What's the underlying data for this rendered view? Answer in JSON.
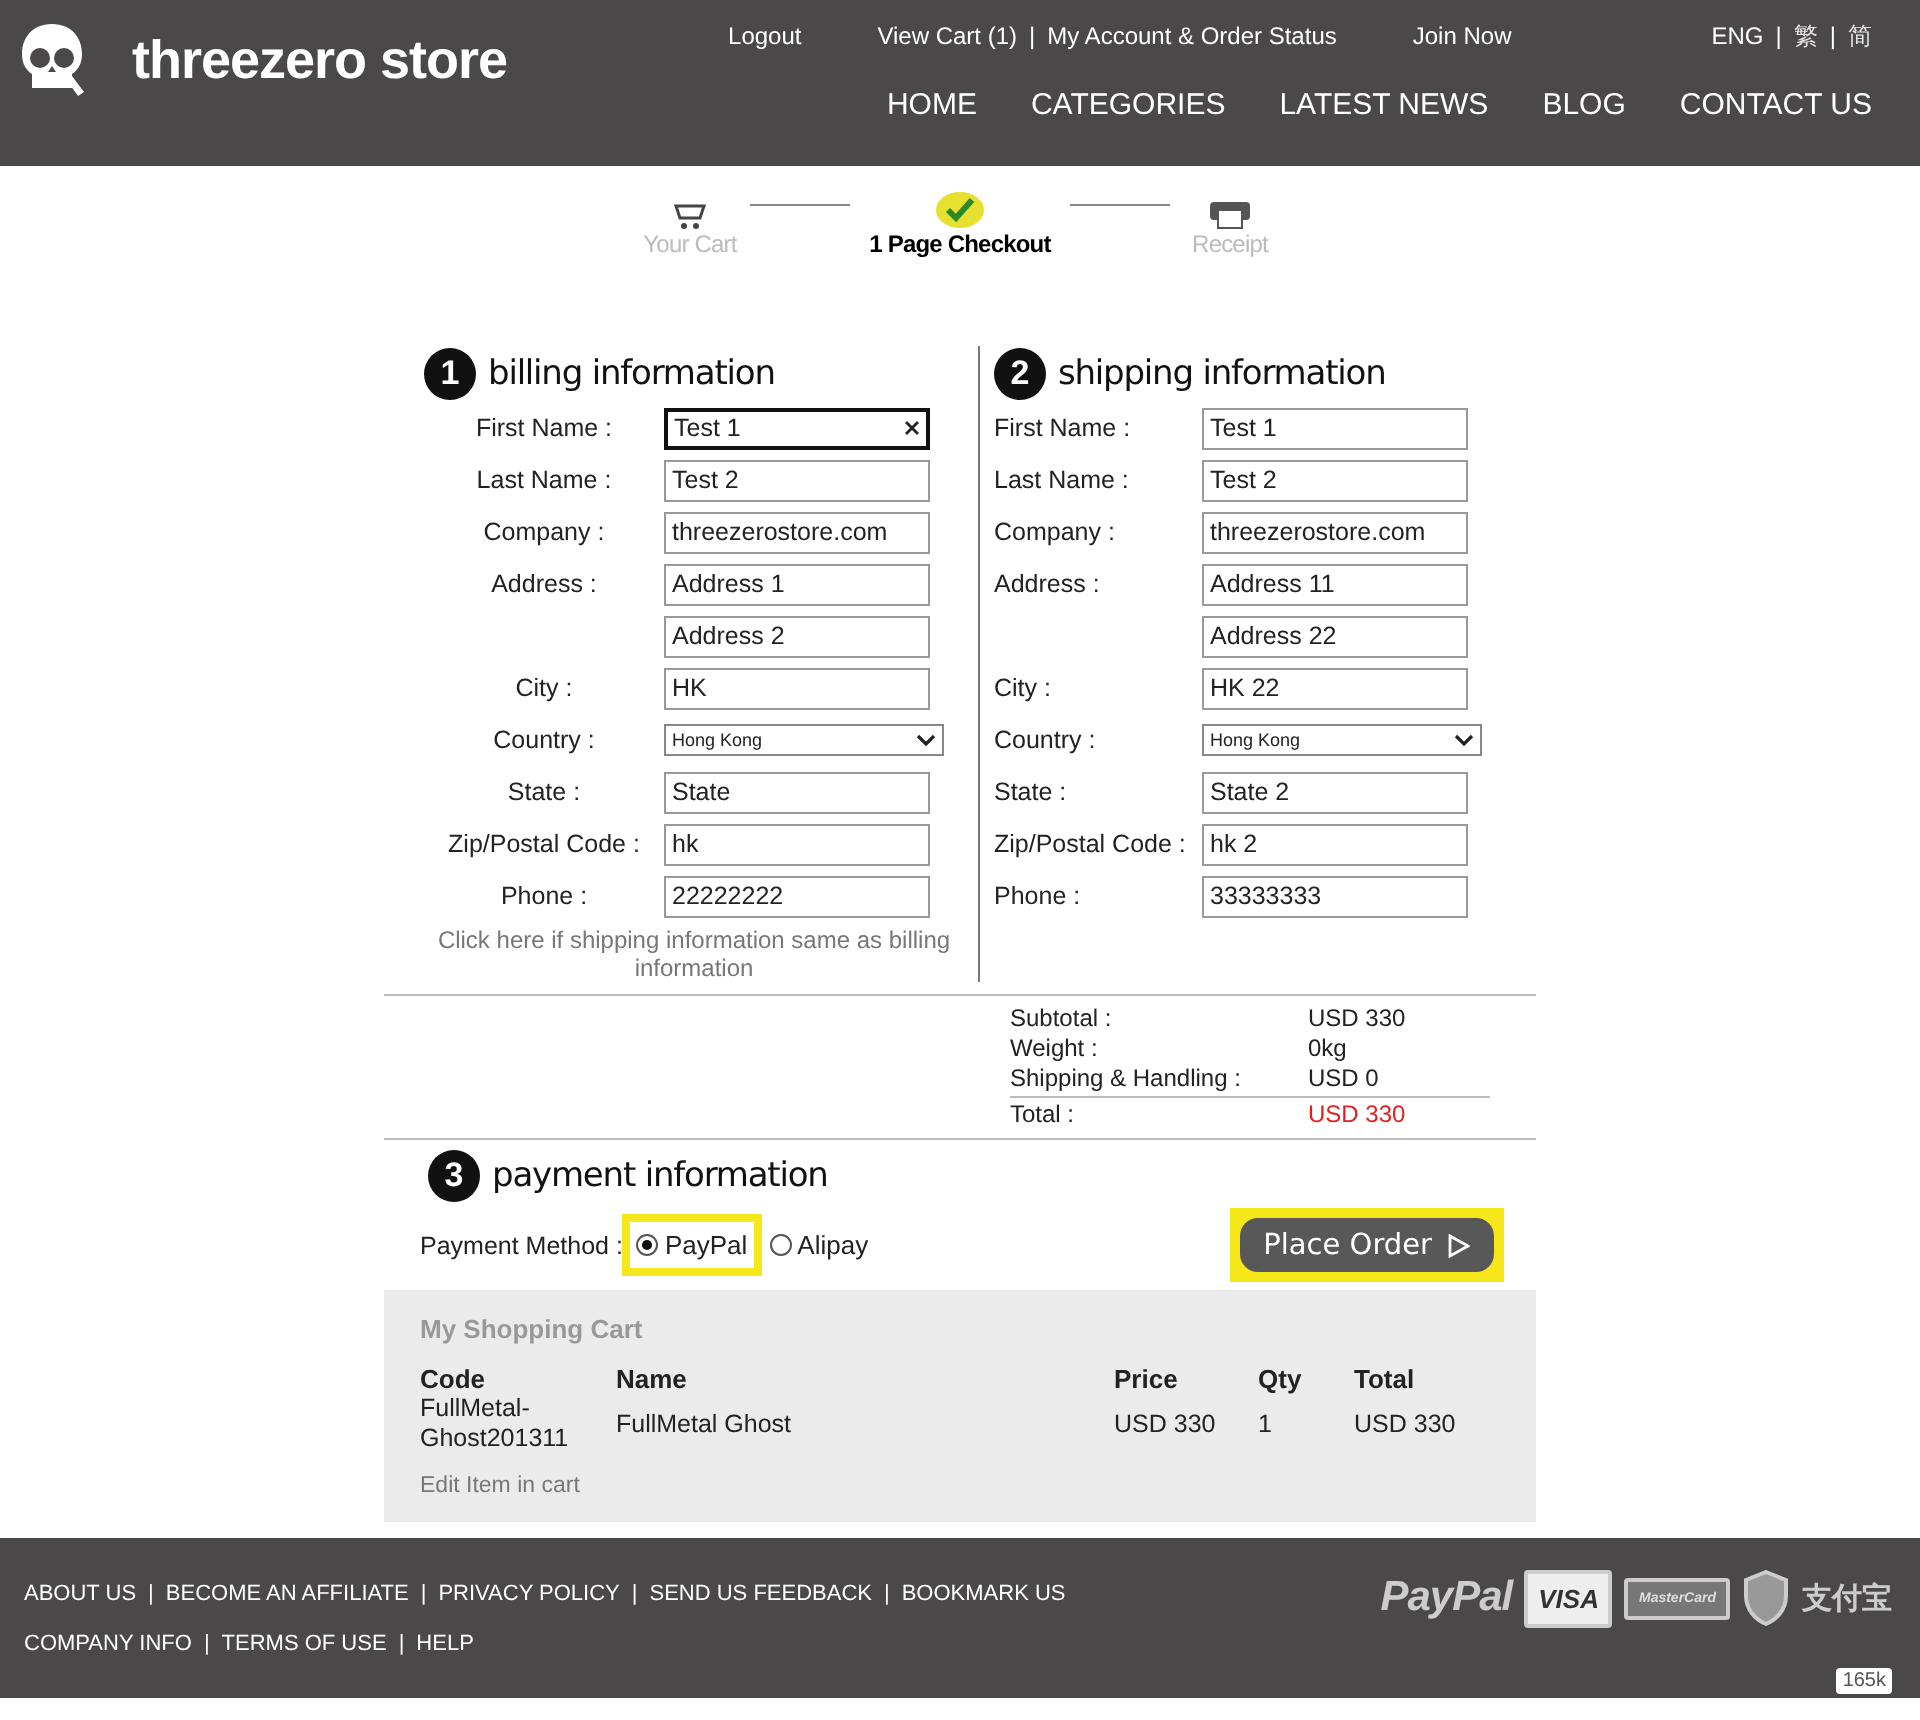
{
  "header": {
    "brand": "threezero store",
    "separator": "|",
    "top_links": [
      [
        "Logout"
      ],
      [
        "View Cart (1)",
        "My Account & Order Status"
      ],
      [
        "Join Now"
      ]
    ],
    "languages": [
      {
        "label": "ENG",
        "selected": true
      },
      {
        "label": "繁",
        "selected": false
      },
      {
        "label": "简",
        "selected": false
      }
    ],
    "nav": [
      "HOME",
      "CATEGORIES",
      "LATEST NEWS",
      "BLOG",
      "CONTACT US"
    ]
  },
  "steps": [
    {
      "label": "Your Cart",
      "kind": "cart",
      "selected": false
    },
    {
      "label": "1 Page Checkout",
      "kind": "check",
      "selected": true
    },
    {
      "label": "Receipt",
      "kind": "receipt",
      "selected": false
    }
  ],
  "billing": {
    "number": "1",
    "title": "billing information",
    "fields": [
      {
        "label": "First Name :",
        "value": "Test 1",
        "kind": "text",
        "focused": true
      },
      {
        "label": "Last Name :",
        "value": "Test 2",
        "kind": "text",
        "focused": false
      },
      {
        "label": "Company :",
        "value": "threezerostore.com",
        "kind": "text",
        "focused": false
      },
      {
        "label": "Address :",
        "value": "Address 1",
        "kind": "text",
        "focused": false
      },
      {
        "value": "Address 2",
        "kind": "text",
        "focused": false
      },
      {
        "label": "City :",
        "value": "HK",
        "kind": "text",
        "focused": false
      },
      {
        "label": "Country :",
        "value": "Hong Kong",
        "kind": "select"
      },
      {
        "label": "State :",
        "value": "State",
        "kind": "text",
        "focused": false
      },
      {
        "label": "Zip/Postal Code :",
        "value": "hk",
        "kind": "text",
        "focused": false
      },
      {
        "label": "Phone :",
        "value": "22222222",
        "kind": "text",
        "focused": false
      }
    ],
    "note": "Click here if shipping information same as billing information"
  },
  "shipping": {
    "number": "2",
    "title": "shipping information",
    "fields": [
      {
        "label": "First Name :",
        "value": "Test 1",
        "kind": "text",
        "focused": false
      },
      {
        "label": "Last Name :",
        "value": "Test 2",
        "kind": "text",
        "focused": false
      },
      {
        "label": "Company :",
        "value": "threezerostore.com",
        "kind": "text",
        "focused": false
      },
      {
        "label": "Address :",
        "value": "Address 11",
        "kind": "text",
        "focused": false
      },
      {
        "value": "Address 22",
        "kind": "text",
        "focused": false
      },
      {
        "label": "City :",
        "value": "HK 22",
        "kind": "text",
        "focused": false
      },
      {
        "label": "Country :",
        "value": "Hong Kong",
        "kind": "select"
      },
      {
        "label": "State :",
        "value": "State 2",
        "kind": "text",
        "focused": false
      },
      {
        "label": "Zip/Postal Code :",
        "value": "hk 2",
        "kind": "text",
        "focused": false
      },
      {
        "label": "Phone :",
        "value": "33333333",
        "kind": "text",
        "focused": false
      }
    ]
  },
  "summary": [
    {
      "label": "Subtotal :",
      "value": "USD 330",
      "emphasis": false
    },
    {
      "label": "Weight :",
      "value": "0kg",
      "emphasis": false
    },
    {
      "label": "Shipping & Handling :",
      "value": "USD 0",
      "emphasis": false
    },
    {
      "label": "Total :",
      "value": "USD 330",
      "emphasis": true
    }
  ],
  "payment": {
    "number": "3",
    "title": "payment information",
    "method_label": "Payment Method :",
    "options": [
      {
        "label": "PayPal",
        "selected": true,
        "highlighted": true
      },
      {
        "label": "Alipay",
        "selected": false,
        "highlighted": false
      }
    ],
    "button": {
      "label": "Place Order",
      "highlighted": true
    }
  },
  "cart": {
    "title": "My Shopping Cart",
    "columns": [
      "Code",
      "Name",
      "Price",
      "Qty",
      "Total"
    ],
    "rows": [
      [
        "FullMetal-Ghost201311",
        "FullMetal Ghost",
        "USD 330",
        "1",
        "USD 330"
      ]
    ],
    "edit_link": "Edit Item in cart"
  },
  "footer": {
    "separator": "|",
    "links": [
      [
        "ABOUT US",
        "BECOME AN AFFILIATE",
        "PRIVACY POLICY",
        "SEND US FEEDBACK",
        "BOOKMARK US"
      ],
      [
        "COMPANY INFO",
        "TERMS OF USE",
        "HELP"
      ]
    ],
    "payment_logos": [
      {
        "label": "PayPal",
        "kind": "paypal"
      },
      {
        "label": "VISA",
        "kind": "visa"
      },
      {
        "label": "MasterCard",
        "kind": "mastercard"
      },
      {
        "label": "支付宝",
        "kind": "alipay"
      }
    ],
    "like_count": "165k"
  }
}
